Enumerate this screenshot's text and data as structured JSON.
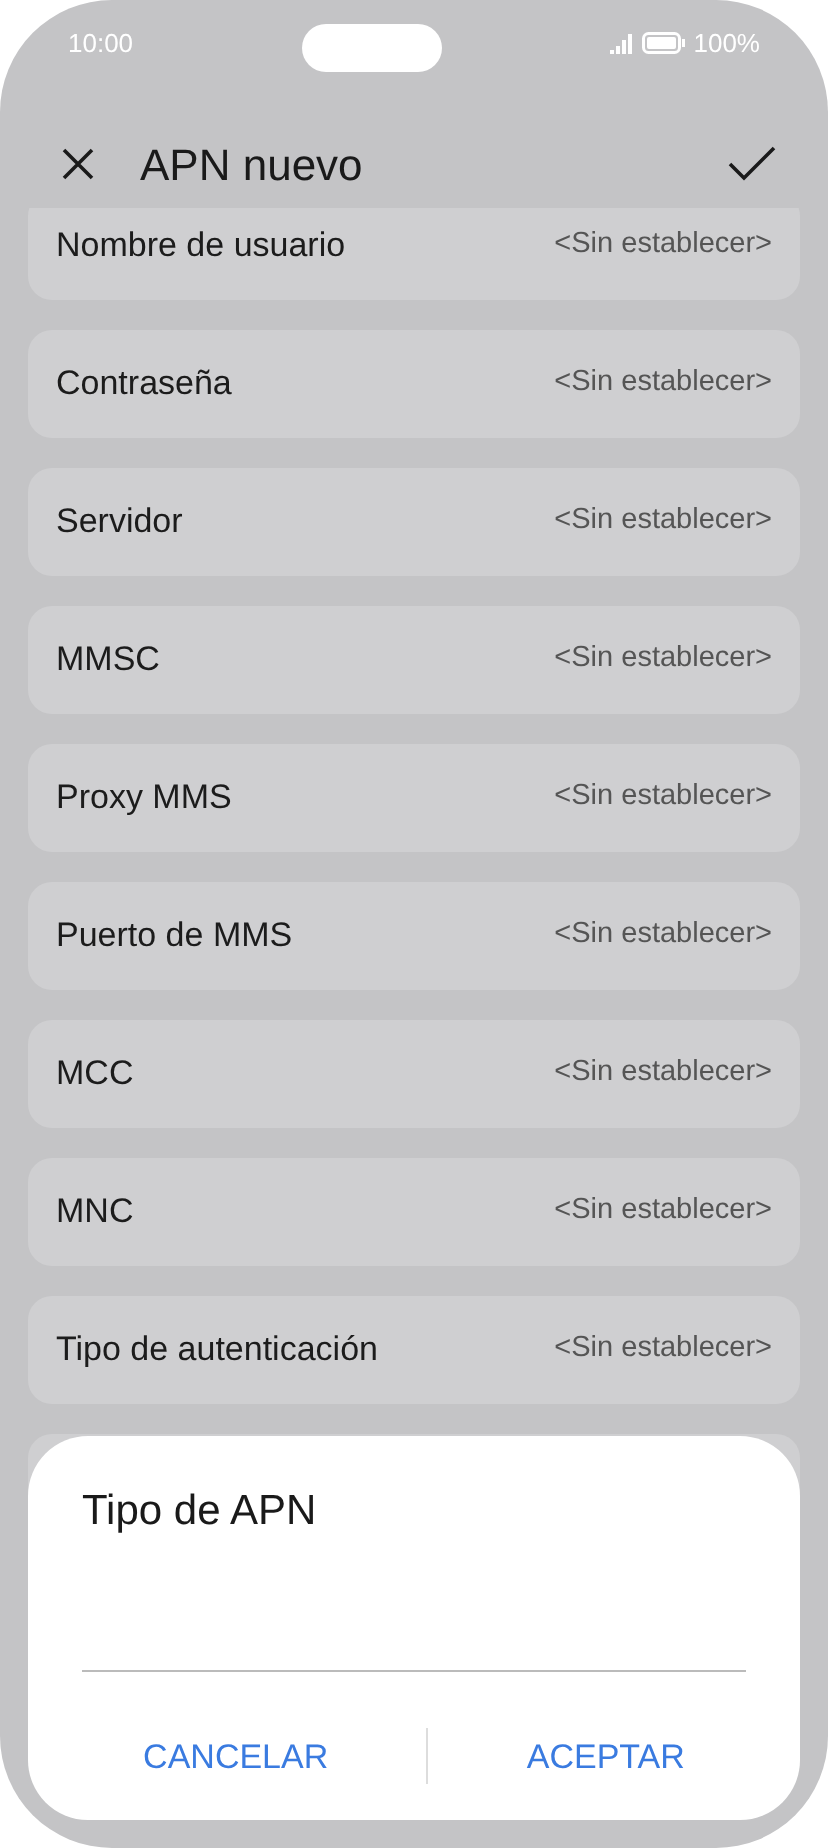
{
  "status_bar": {
    "time": "10:00",
    "battery": "100%"
  },
  "header": {
    "title": "APN nuevo"
  },
  "settings": [
    {
      "label": "Nombre de usuario",
      "value": "<Sin establecer>"
    },
    {
      "label": "Contraseña",
      "value": "<Sin establecer>"
    },
    {
      "label": "Servidor",
      "value": "<Sin establecer>"
    },
    {
      "label": "MMSC",
      "value": "<Sin establecer>"
    },
    {
      "label": "Proxy MMS",
      "value": "<Sin establecer>"
    },
    {
      "label": "Puerto de MMS",
      "value": "<Sin establecer>"
    },
    {
      "label": "MCC",
      "value": "<Sin establecer>"
    },
    {
      "label": "MNC",
      "value": "<Sin establecer>"
    },
    {
      "label": "Tipo de autenticación",
      "value": "<Sin establecer>"
    }
  ],
  "dialog": {
    "title": "Tipo de APN",
    "buttons": [
      "CANCELAR",
      "ACEPTAR"
    ]
  }
}
